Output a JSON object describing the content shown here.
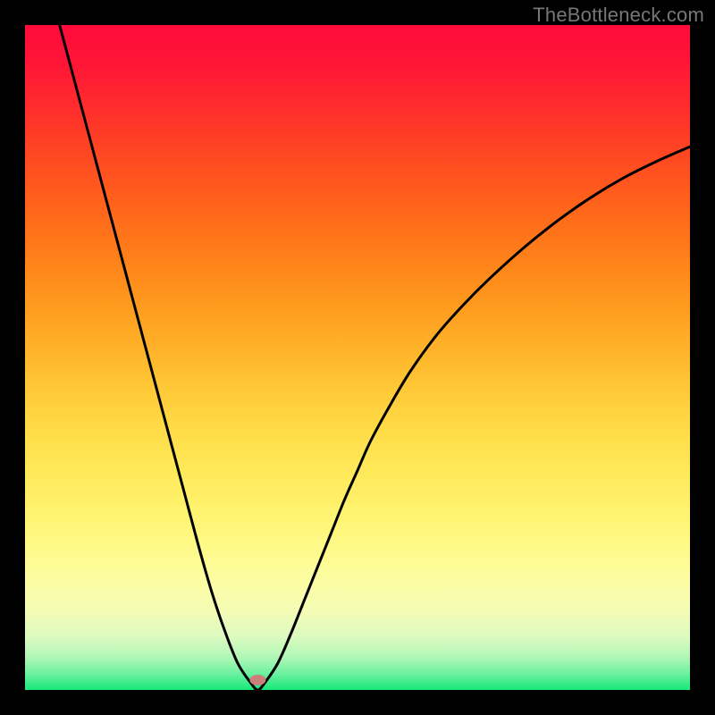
{
  "watermark": "TheBottleneck.com",
  "colors": {
    "frame": "#000000",
    "curve": "#000000",
    "marker": "#cc7f7a",
    "watermark": "#777777",
    "gradient_stops": [
      {
        "offset": 0.0,
        "color": "#ff0a3a"
      },
      {
        "offset": 0.06,
        "color": "#ff1637"
      },
      {
        "offset": 0.12,
        "color": "#ff2b2d"
      },
      {
        "offset": 0.18,
        "color": "#ff4224"
      },
      {
        "offset": 0.24,
        "color": "#ff581e"
      },
      {
        "offset": 0.3,
        "color": "#ff6e1a"
      },
      {
        "offset": 0.36,
        "color": "#ff841a"
      },
      {
        "offset": 0.42,
        "color": "#ff9a1e"
      },
      {
        "offset": 0.48,
        "color": "#ffb028"
      },
      {
        "offset": 0.54,
        "color": "#ffc635"
      },
      {
        "offset": 0.6,
        "color": "#ffd945"
      },
      {
        "offset": 0.66,
        "color": "#ffe756"
      },
      {
        "offset": 0.72,
        "color": "#fff16a"
      },
      {
        "offset": 0.78,
        "color": "#fff985"
      },
      {
        "offset": 0.83,
        "color": "#fdfda0"
      },
      {
        "offset": 0.88,
        "color": "#f4fcb5"
      },
      {
        "offset": 0.92,
        "color": "#dcfac0"
      },
      {
        "offset": 0.95,
        "color": "#b2f7b8"
      },
      {
        "offset": 0.975,
        "color": "#6ef1a0"
      },
      {
        "offset": 1.0,
        "color": "#18e879"
      }
    ]
  },
  "chart_data": {
    "type": "line",
    "title": "",
    "xlabel": "",
    "ylabel": "",
    "xlim": [
      0,
      100
    ],
    "ylim": [
      0,
      100
    ],
    "x": [
      0,
      2,
      4,
      6,
      8,
      10,
      12,
      14,
      16,
      18,
      20,
      22,
      24,
      26,
      28,
      30,
      32,
      34,
      35,
      36,
      38,
      40,
      42,
      44,
      46,
      48,
      50,
      52,
      55,
      58,
      62,
      66,
      70,
      75,
      80,
      85,
      90,
      95,
      100
    ],
    "values": [
      120,
      112,
      104.5,
      97,
      89.5,
      82,
      74.5,
      67,
      59.5,
      52,
      44.5,
      37,
      29.5,
      22,
      15,
      9,
      4,
      1,
      0,
      1,
      4,
      8.5,
      13.5,
      18.5,
      23.5,
      28.5,
      33,
      37.5,
      43,
      48,
      53.5,
      58,
      62,
      66.5,
      70.5,
      74,
      77,
      79.5,
      81.7
    ],
    "marker": {
      "x": 35,
      "y": 1.5
    },
    "note": "V-shaped bottleneck curve. x is a normalized component-strength axis (0–100); y is bottleneck percentage (0 = balanced, higher = worse). Minimum near x≈35. Left branch starts above the visible top (y≈120) producing a clip at the upper-left edge; right branch is concave and asymptotes near y≈82 at x=100."
  }
}
